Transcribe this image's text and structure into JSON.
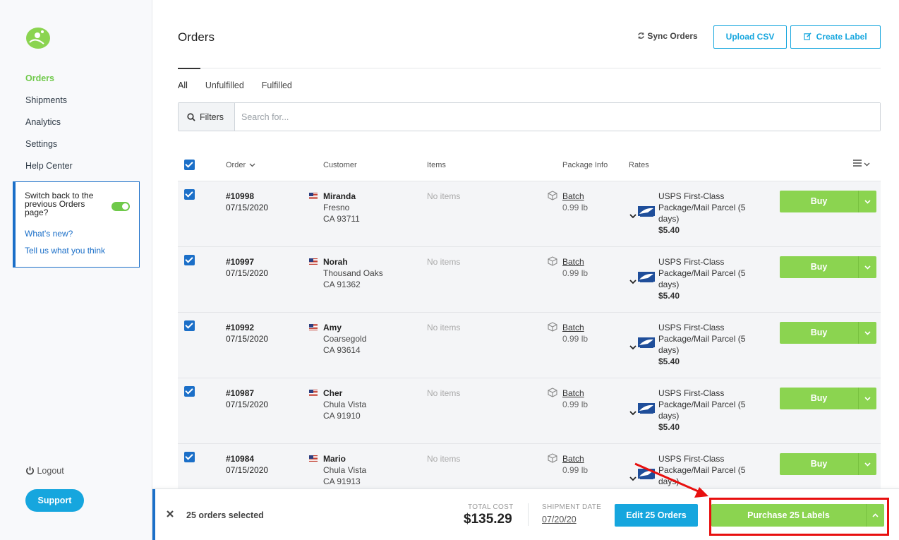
{
  "sidebar": {
    "nav": [
      "Orders",
      "Shipments",
      "Analytics",
      "Settings",
      "Help Center"
    ],
    "switch_text": "Switch back to the previous Orders page?",
    "whats_new": "What's new?",
    "feedback": "Tell us what you think",
    "logout": "Logout",
    "support": "Support"
  },
  "header": {
    "title": "Orders",
    "sync": "Sync Orders",
    "upload": "Upload CSV",
    "create": "Create Label"
  },
  "tabs": [
    "All",
    "Unfulfilled",
    "Fulfilled"
  ],
  "search": {
    "filters": "Filters",
    "placeholder": "Search for..."
  },
  "columns": {
    "order": "Order",
    "customer": "Customer",
    "items": "Items",
    "package": "Package Info",
    "rates": "Rates"
  },
  "orders": [
    {
      "id": "#10998",
      "date": "07/15/2020",
      "name": "Miranda",
      "city": "Fresno",
      "state_zip": "CA 93711",
      "items": "No items",
      "package": "Batch",
      "weight": "0.99 lb",
      "rate_line1": "USPS First-Class",
      "rate_line2": "Package/Mail Parcel  (5",
      "rate_line3": "days)",
      "price": "$5.40",
      "buy": "Buy"
    },
    {
      "id": "#10997",
      "date": "07/15/2020",
      "name": "Norah",
      "city": "Thousand Oaks",
      "state_zip": "CA 91362",
      "items": "No items",
      "package": "Batch",
      "weight": "0.99 lb",
      "rate_line1": "USPS First-Class",
      "rate_line2": "Package/Mail Parcel  (5",
      "rate_line3": "days)",
      "price": "$5.40",
      "buy": "Buy"
    },
    {
      "id": "#10992",
      "date": "07/15/2020",
      "name": "Amy",
      "city": "Coarsegold",
      "state_zip": "CA 93614",
      "items": "No items",
      "package": "Batch",
      "weight": "0.99 lb",
      "rate_line1": "USPS First-Class",
      "rate_line2": "Package/Mail Parcel  (5",
      "rate_line3": "days)",
      "price": "$5.40",
      "buy": "Buy"
    },
    {
      "id": "#10987",
      "date": "07/15/2020",
      "name": "Cher",
      "city": "Chula Vista",
      "state_zip": "CA 91910",
      "items": "No items",
      "package": "Batch",
      "weight": "0.99 lb",
      "rate_line1": "USPS First-Class",
      "rate_line2": "Package/Mail Parcel  (5",
      "rate_line3": "days)",
      "price": "$5.40",
      "buy": "Buy"
    },
    {
      "id": "#10984",
      "date": "07/15/2020",
      "name": "Mario",
      "city": "Chula Vista",
      "state_zip": "CA 91913",
      "items": "No items",
      "package": "Batch",
      "weight": "0.99 lb",
      "rate_line1": "USPS First-Class",
      "rate_line2": "Package/Mail Parcel  (5",
      "rate_line3": "days)",
      "price": "",
      "buy": "Buy"
    }
  ],
  "bottom": {
    "selected": "25 orders selected",
    "total_label": "TOTAL COST",
    "total": "$135.29",
    "ship_label": "SHIPMENT DATE",
    "ship_date": "07/20/20",
    "edit": "Edit 25 Orders",
    "purchase": "Purchase 25 Labels"
  },
  "colors": {
    "brand_green": "#8bd450",
    "accent_blue": "#16a6de",
    "link_blue": "#1b6fc8",
    "annotation_red": "#e8100f"
  },
  "icons": [
    "logo-icon",
    "refresh-icon",
    "edit-icon",
    "search-icon",
    "chevron-down-icon",
    "menu-icon",
    "flag-us-icon",
    "package-icon",
    "usps-icon",
    "power-icon",
    "close-icon",
    "chevron-up-icon"
  ]
}
